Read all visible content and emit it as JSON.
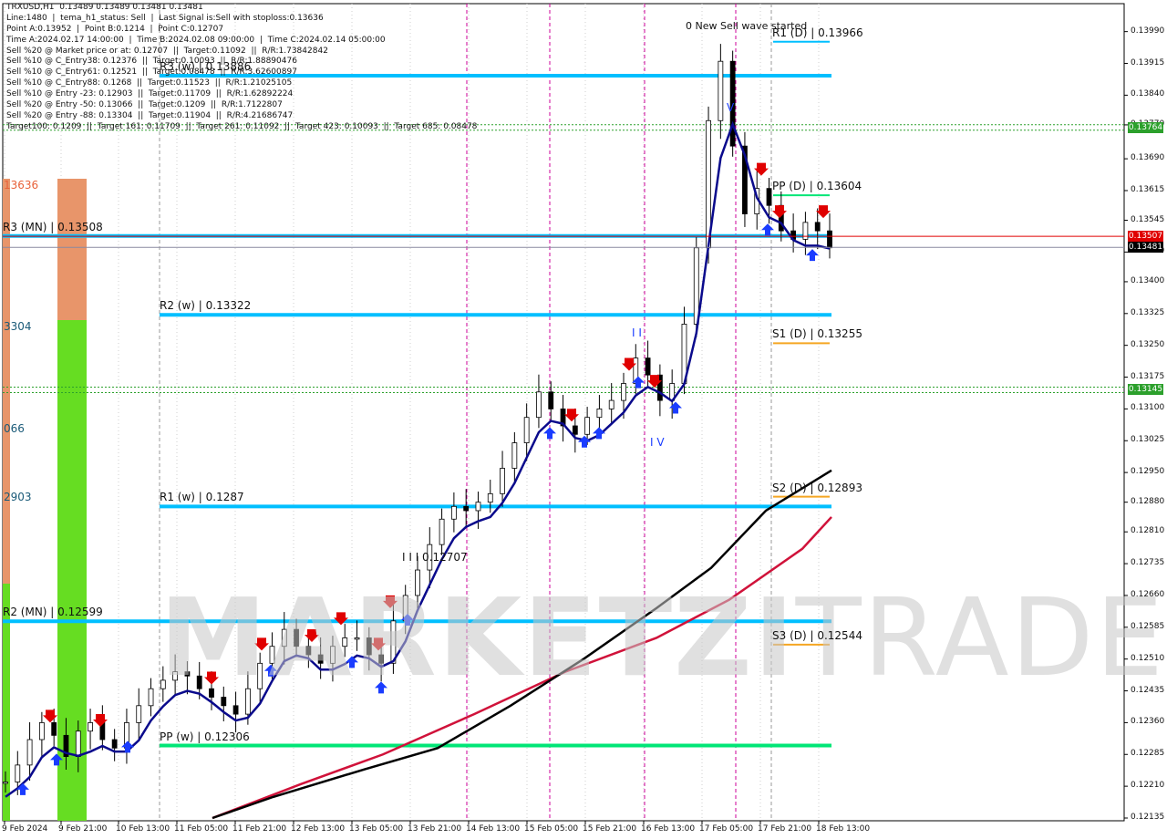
{
  "info_lines": [
    "TRXUSD,H1  0.13489 0.13489 0.13481 0.13481",
    "Line:1480  |  tema_h1_status: Sell  |  Last Signal is:Sell with stoploss:0.13636",
    "Point A:0.13952  |  Point B:0.1214  |  Point C:0.12707",
    "Time A:2024.02.17 14:00:00  |  Time B:2024.02.08 09:00:00  |  Time C:2024.02.14 05:00:00",
    "Sell %20 @ Market price or at: 0.12707  ||  Target:0.11092  ||  R/R:1.73842842",
    "Sell %10 @ C_Entry38: 0.12376  ||  Target:0.10093  ||  R/R:1.88890476",
    "Sell %10 @ C_Entry61: 0.12521  ||  Target:0.08478  ||  R/R:3.62600897",
    "Sell %10 @ C_Entry88: 0.1268  ||  Target:0.11523  ||  R/R:1.21025105",
    "Sell %10 @ Entry -23: 0.12903  ||  Target:0.11709  ||  R/R:1.62892224",
    "Sell %20 @ Entry -50: 0.13066  ||  Target:0.1209  ||  R/R:1.7122807",
    "Sell %20 @ Entry -88: 0.13304  ||  Target:0.11904  ||  R/R:4.21686747",
    "Target100: 0.1209  ||  Target 161: 0.11709  ||  Target 261: 0.11092  ||  Target 423: 0.10093  ||  Target 685: 0.08478"
  ],
  "watermark": {
    "part1": "MARKETZI",
    "part2": "TRADE"
  },
  "annotations": {
    "wave_text": "0 New Sell wave started",
    "wave_iii": "I I I  0.12707",
    "wave_iv": "I V",
    "wave_v": "V",
    "wave_i": "I I"
  },
  "left_labels": [
    "13636",
    "3304",
    "066",
    "2903"
  ],
  "colors": {
    "background": "#ffffff",
    "candle": "#000000",
    "tema": "#0a0a8c",
    "ma_black": "#000000",
    "ma_red": "#d0123a",
    "pivot_level": "#00bfff",
    "pp_week": "#00e676",
    "daily_level": "#f5a623",
    "sell_arrow": "#e00000",
    "buy_arrow": "#1a3cff",
    "vline": "#cc0099",
    "bid_line": "#e00000",
    "zone_green": "#2ca02c",
    "orange_bar": "#e8956a",
    "green_bar": "#66dd22"
  },
  "chart_data": {
    "type": "candlestick",
    "symbol": "TRXUSD",
    "timeframe": "H1",
    "ylim": [
      0.12135,
      0.14
    ],
    "price_ticks": [
      "0.13990",
      "0.13915",
      "0.13840",
      "0.13770",
      "0.13690",
      "0.13615",
      "0.13545",
      "0.13470",
      "0.13400",
      "0.13325",
      "0.13250",
      "0.13175",
      "0.13100",
      "0.13025",
      "0.12950",
      "0.12880",
      "0.12810",
      "0.12735",
      "0.12660",
      "0.12585",
      "0.12510",
      "0.12435",
      "0.12360",
      "0.12285",
      "0.12210",
      "0.12135"
    ],
    "time_ticks": [
      "9 Feb 2024",
      "9 Feb 21:00",
      "10 Feb 13:00",
      "11 Feb 05:00",
      "11 Feb 21:00",
      "12 Feb 13:00",
      "13 Feb 05:00",
      "13 Feb 21:00",
      "14 Feb 13:00",
      "15 Feb 05:00",
      "15 Feb 21:00",
      "16 Feb 13:00",
      "17 Feb 05:00",
      "17 Feb 21:00",
      "18 Feb 13:00"
    ],
    "levels": [
      {
        "label": "R3 (MN) | 0.13508",
        "value": 0.13508,
        "kind": "pivot"
      },
      {
        "label": "R2 (w) | 0.13322",
        "value": 0.13322,
        "kind": "pivot"
      },
      {
        "label": "R1 (w) | 0.1287",
        "value": 0.1287,
        "kind": "pivot"
      },
      {
        "label": "R2 (MN) | 0.12599",
        "value": 0.12599,
        "kind": "pivot"
      },
      {
        "label": "PP (w) | 0.12306",
        "value": 0.12306,
        "kind": "pp"
      },
      {
        "label": "R3 (w) | 0.13886",
        "value": 0.13886,
        "kind": "pivot"
      },
      {
        "label": "R1 (D) | 0.13966",
        "value": 0.13966,
        "kind": "daily"
      },
      {
        "label": "PP (D) | 0.13604",
        "value": 0.13604,
        "kind": "daily"
      },
      {
        "label": "S1 (D) | 0.13255",
        "value": 0.13255,
        "kind": "daily"
      },
      {
        "label": "S2 (D) | 0.12893",
        "value": 0.12893,
        "kind": "daily"
      },
      {
        "label": "S3 (D) | 0.12544",
        "value": 0.12544,
        "kind": "daily"
      }
    ],
    "zones": [
      {
        "label": "0.13764",
        "value": 0.13764,
        "second": "0.13773"
      },
      {
        "label": "0.13145",
        "value": 0.13145,
        "second": "0.13156"
      }
    ],
    "current_price": {
      "bid": "0.13481",
      "stop": "0.13507"
    },
    "close_path": [
      0.1222,
      0.1226,
      0.1232,
      0.1236,
      0.1233,
      0.1228,
      0.1234,
      0.1236,
      0.1232,
      0.123,
      0.1236,
      0.124,
      0.1244,
      0.1246,
      0.1248,
      0.1247,
      0.1244,
      0.1242,
      0.124,
      0.1238,
      0.1244,
      0.125,
      0.1254,
      0.1258,
      0.1254,
      0.1252,
      0.125,
      0.1254,
      0.1256,
      0.1256,
      0.1252,
      0.125,
      0.126,
      0.1266,
      0.1272,
      0.1278,
      0.1284,
      0.1287,
      0.1286,
      0.1288,
      0.129,
      0.1296,
      0.1302,
      0.1308,
      0.1314,
      0.131,
      0.1306,
      0.1304,
      0.1308,
      0.131,
      0.1312,
      0.1316,
      0.1322,
      0.1318,
      0.1312,
      0.1316,
      0.133,
      0.1348,
      0.1378,
      0.1392,
      0.1372,
      0.1356,
      0.1362,
      0.1358,
      0.1352,
      0.135,
      0.1354,
      0.1352,
      0.1348
    ]
  }
}
